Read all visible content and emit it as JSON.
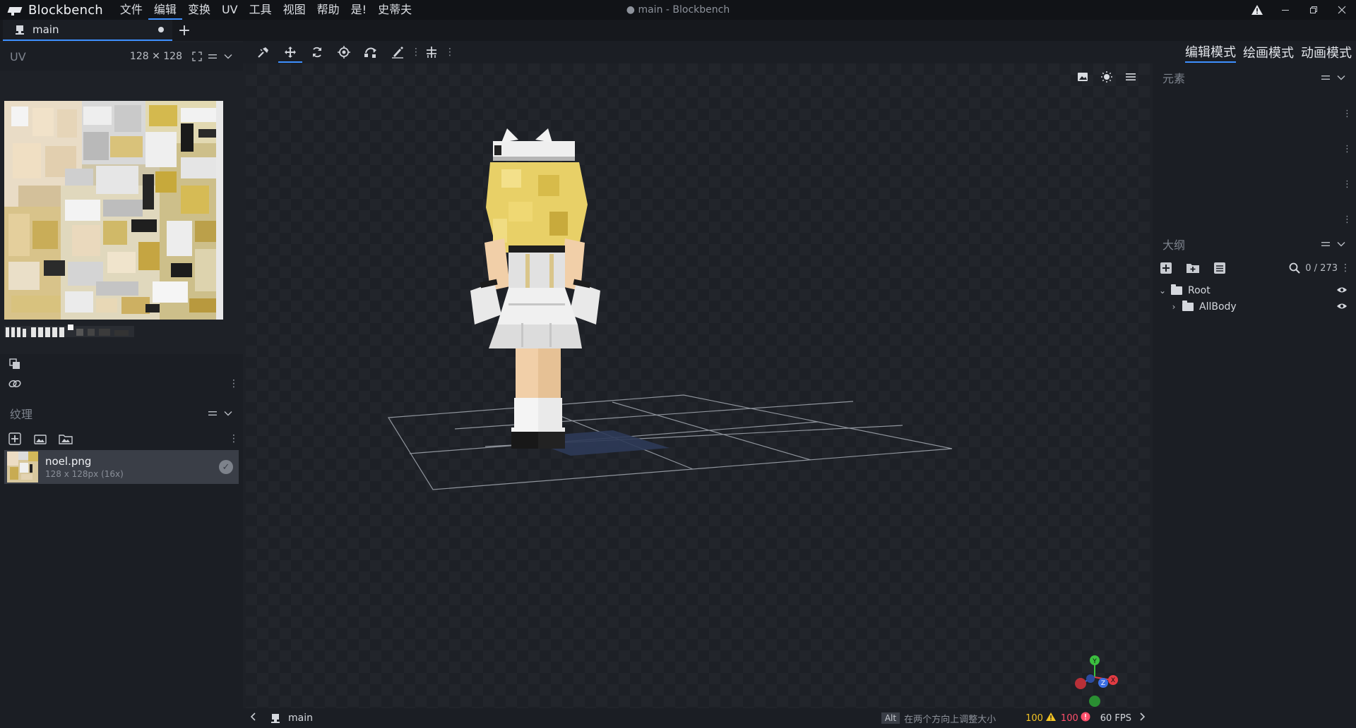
{
  "app": {
    "name": "Blockbench",
    "window_title": "● main - Blockbench",
    "menu": [
      "文件",
      "编辑",
      "变换",
      "UV",
      "工具",
      "视图",
      "帮助",
      "是!",
      "史蒂夫"
    ]
  },
  "tabs": [
    {
      "label": "main",
      "modified": true
    }
  ],
  "uv_panel": {
    "title": "UV",
    "resolution": "128 ✕ 128"
  },
  "textures_panel": {
    "title": "纹理",
    "items": [
      {
        "name": "noel.png",
        "size": "128 x 128px (16x)",
        "selected": true
      }
    ]
  },
  "modes": [
    "编辑模式",
    "绘画模式",
    "动画模式"
  ],
  "active_mode": "编辑模式",
  "elements_panel": {
    "title": "元素"
  },
  "outliner": {
    "title": "大纲",
    "count": "0 / 273",
    "nodes": [
      {
        "name": "Root",
        "expanded": true,
        "depth": 0
      },
      {
        "name": "AllBody",
        "expanded": false,
        "depth": 1
      }
    ]
  },
  "status": {
    "file": "main",
    "key": "Alt",
    "hint": "在两个方向上调整大小",
    "warnings": "100",
    "errors": "100",
    "fps": "60 FPS"
  },
  "axes": {
    "y": "Y",
    "x": "X",
    "z": "Z"
  },
  "colors": {
    "accent": "#3e90ff",
    "warning": "#f3c323",
    "error": "#ff4f6b",
    "axis_x": "#e23b43",
    "axis_y": "#3bbf3f",
    "axis_z": "#3b6ee2"
  }
}
